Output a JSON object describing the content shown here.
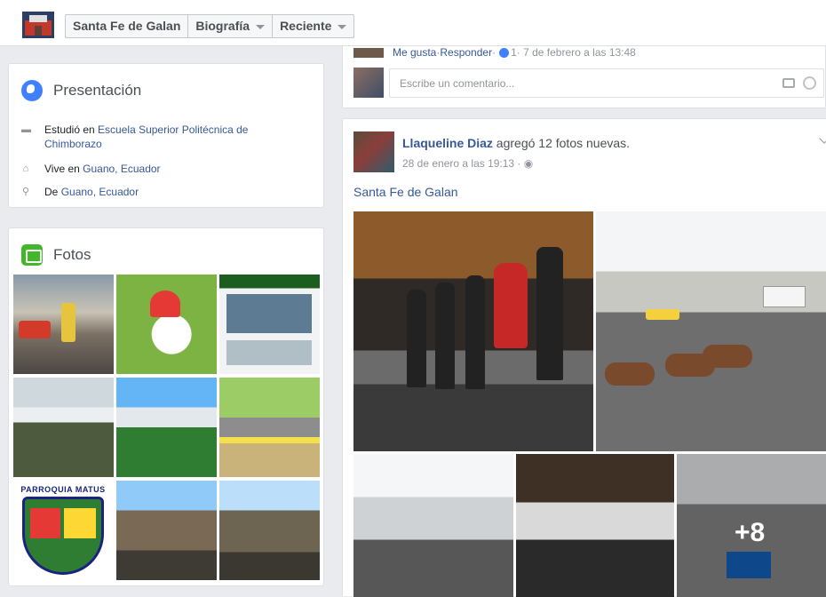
{
  "header": {
    "breadcrumbs": [
      "Santa Fe de Galan",
      "Biografía",
      "Reciente"
    ]
  },
  "intro": {
    "title": "Presentación",
    "studied_prefix": "Estudió en ",
    "studied_place": "Escuela Superior Politécnica de Chimborazo",
    "lives_prefix": "Vive en ",
    "lives_place": "Guano, Ecuador",
    "from_prefix": "De ",
    "from_place": "Guano, Ecuador"
  },
  "photos": {
    "title": "Fotos",
    "logo_text": "PARROQUIA MATUS"
  },
  "comment": {
    "meta_like": "Me gusta",
    "meta_sep": " · ",
    "meta_reply": "Responder",
    "meta_sep2": " · ",
    "meta_count": "1",
    "meta_time": " · 7 de febrero a las 13:48",
    "placeholder": "Escribe un comentario..."
  },
  "post": {
    "author": "Llaqueline Diaz",
    "action": " agregó 12 fotos nuevas.",
    "time": "28 de enero a las 19:13 · ",
    "text": "Santa Fe de Galan",
    "more_photos": "+8"
  },
  "colors": {
    "link": "#365899",
    "background": "#e9ebee",
    "intro_icon": "#4080ff",
    "photos_icon": "#42b72a"
  }
}
